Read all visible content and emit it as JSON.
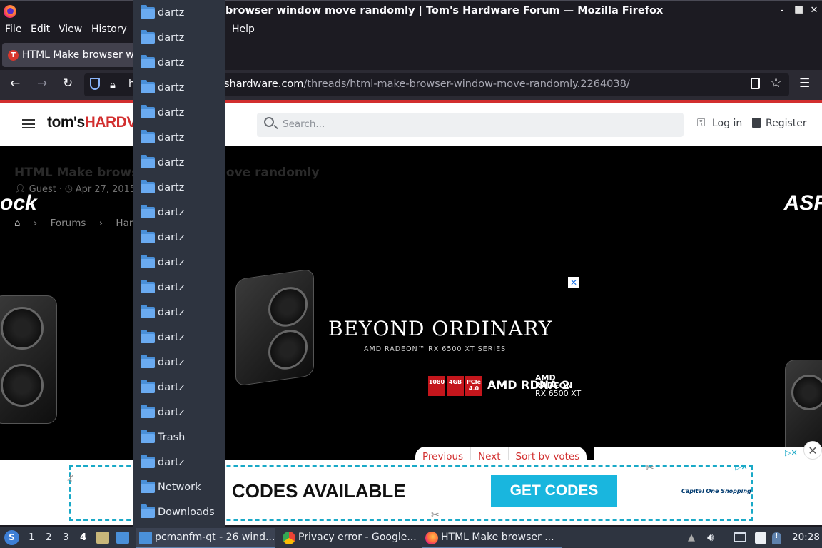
{
  "window": {
    "title": "browser window move randomly | Tom's Hardware Forum — Mozilla Firefox",
    "controls": [
      "‑",
      "⬜",
      "✕"
    ]
  },
  "menubar": {
    "items": [
      "File",
      "Edit",
      "View",
      "History",
      "Help"
    ]
  },
  "tab": {
    "label": "HTML Make browser wi",
    "favicon": "T"
  },
  "urlbar": {
    "host_prefix": "h",
    "host_visible": "shardware.com",
    "path": "/threads/html-make-browser-window-move-randomly.2264038/"
  },
  "site": {
    "logo_prefix": "tom's",
    "logo_suffix": "HARDV",
    "search_placeholder": "Search...",
    "login": "Log in",
    "register": "Register"
  },
  "thread": {
    "title": "HTML Make browser window move randomly",
    "author": "Guest",
    "date": "Apr 27, 2015",
    "breadcrumbs": [
      "Forums",
      "Hardv"
    ]
  },
  "ad": {
    "brand_left": "ock",
    "brand_right": "ASR",
    "headline": "BEYOND ORDINARY",
    "subline": "AMD RADEON™ RX 6500 XT SERIES",
    "badges": [
      "1080",
      "4GB",
      "PCIe 4.0"
    ],
    "rdna": "AMD RDNA 2",
    "radeon_lines": [
      "AMD",
      "RADEON",
      "RX 6500 XT"
    ],
    "close": "✕"
  },
  "pager": {
    "previous": "Previous",
    "next": "Next",
    "sort": "Sort by votes"
  },
  "bottom_ad": {
    "codes_text": "CODES AVAILABLE",
    "button": "GET CODES",
    "sponsor": "Capital One Shopping",
    "close": "✕"
  },
  "file_manager": {
    "items": [
      "dartz",
      "dartz",
      "dartz",
      "dartz",
      "dartz",
      "dartz",
      "dartz",
      "dartz",
      "dartz",
      "dartz",
      "dartz",
      "dartz",
      "dartz",
      "dartz",
      "dartz",
      "dartz",
      "dartz",
      "Trash",
      "dartz",
      "Network",
      "Downloads"
    ]
  },
  "taskbar": {
    "workspaces": [
      "1",
      "2",
      "3",
      "4"
    ],
    "active_workspace": "4",
    "tasks": [
      {
        "label": "pcmanfm-qt - 26 wind...",
        "icon": "folder-icon",
        "color": "#4a90d9"
      },
      {
        "label": "Privacy error - Google...",
        "icon": "chrome-icon",
        "color": "#34a853"
      },
      {
        "label": "HTML Make browser ...",
        "icon": "firefox-icon",
        "color": "#ff7139"
      }
    ],
    "clock": "20:28"
  },
  "colors": {
    "accent_red": "#d22f2f",
    "taskbar_bg": "#2e3440",
    "firefox_bg": "#1c1b22"
  }
}
